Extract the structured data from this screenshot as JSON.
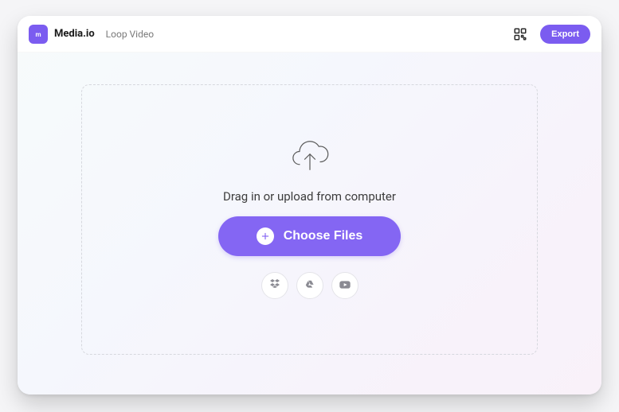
{
  "header": {
    "brand": "Media.io",
    "tool_name": "Loop Video",
    "export_label": "Export"
  },
  "dropzone": {
    "instruction": "Drag in or upload from computer",
    "choose_label": "Choose Files"
  },
  "sources": {
    "dropbox": "dropbox",
    "google_drive": "google-drive",
    "youtube": "youtube"
  },
  "colors": {
    "accent": "#7b5cf0",
    "button": "#8466f3"
  }
}
